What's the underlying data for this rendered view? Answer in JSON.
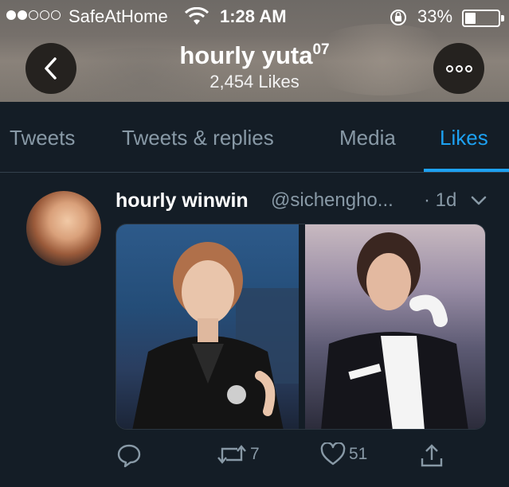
{
  "status_bar": {
    "carrier": "SafeAtHome",
    "time": "1:28 AM",
    "battery_percent": "33%",
    "battery_level": 0.33,
    "signal_dots_filled": 2,
    "signal_dots_total": 5,
    "icons": [
      "wifi-icon",
      "rotation-lock-icon",
      "battery-icon"
    ]
  },
  "header": {
    "title": "hourly yuta",
    "title_superscript": "07",
    "likes_count": "2,454 Likes",
    "back_icon": "chevron-left-icon",
    "more_icon": "more-horizontal-icon"
  },
  "tabs": [
    {
      "label": "Tweets",
      "active": false
    },
    {
      "label": "Tweets & replies",
      "active": false
    },
    {
      "label": "Media",
      "active": false
    },
    {
      "label": "Likes",
      "active": true
    }
  ],
  "tweet": {
    "author_name": "hourly winwin",
    "author_handle": "@sichengho...",
    "time": "· 1d",
    "menu_icon": "chevron-down-icon",
    "media_count": 2,
    "actions": {
      "reply_icon": "reply-icon",
      "retweet_icon": "retweet-icon",
      "retweet_count": "7",
      "like_icon": "heart-icon",
      "like_count": "51",
      "share_icon": "share-icon"
    }
  },
  "colors": {
    "background": "#141d26",
    "accent": "#1da1f2",
    "muted_text": "#8899a6",
    "divider": "#33404d"
  }
}
